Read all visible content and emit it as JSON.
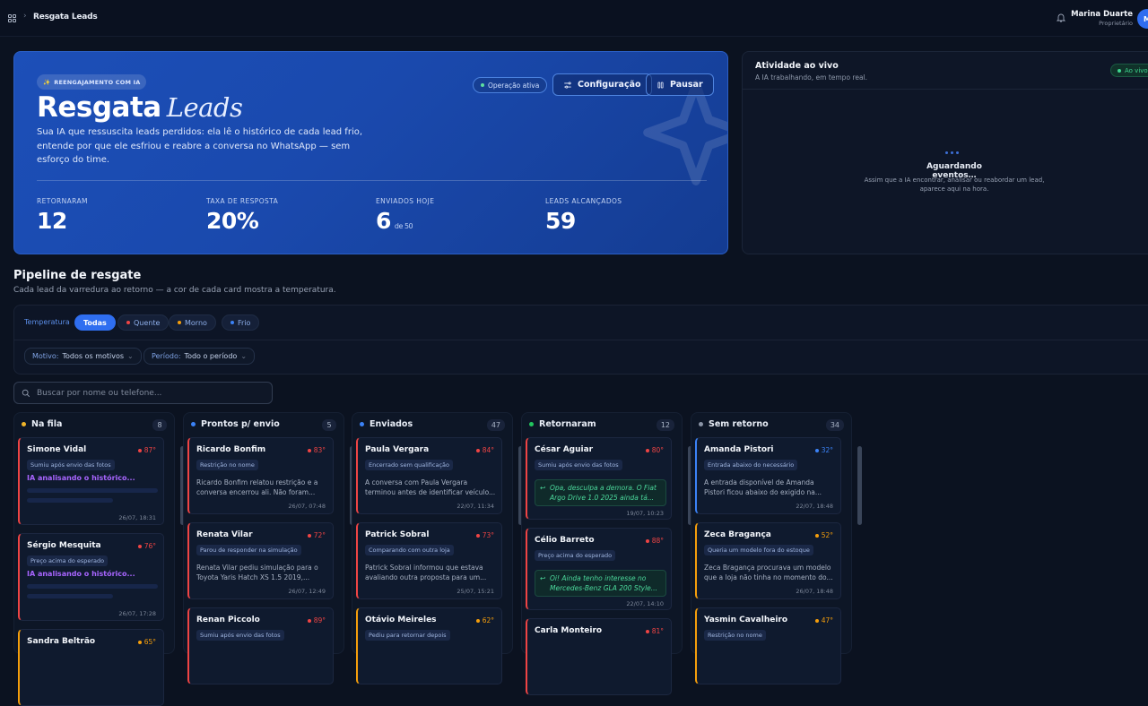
{
  "topbar": {
    "breadcrumb": "Resgata Leads",
    "user_name": "Marina Duarte",
    "user_role": "Proprietário",
    "avatar_initial": "M"
  },
  "hero": {
    "badge": "REENGAJAMENTO COM IA",
    "title_bold": "Resgata",
    "title_italic": "Leads",
    "description": "Sua IA que ressuscita leads perdidos: ela lê o histórico de cada lead frio, entende por que ele esfriou e reabre a conversa no WhatsApp — sem esforço do time.",
    "status": "Operação ativa",
    "config_label": "Configuração",
    "pause_label": "Pausar",
    "stats": [
      {
        "label": "RETORNARAM",
        "value": "12",
        "suffix": ""
      },
      {
        "label": "TAXA DE RESPOSTA",
        "value": "20%",
        "suffix": ""
      },
      {
        "label": "ENVIADOS HOJE",
        "value": "6",
        "suffix": "de 50"
      },
      {
        "label": "LEADS ALCANÇADOS",
        "value": "59",
        "suffix": ""
      }
    ]
  },
  "activity": {
    "title": "Atividade ao vivo",
    "subtitle": "A IA trabalhando, em tempo real.",
    "live": "Ao vivo",
    "waiting": "Aguardando eventos…",
    "help": "Assim que a IA encontrar, analisar ou reabordar um lead, aparece aqui na hora."
  },
  "pipeline": {
    "title": "Pipeline de resgate",
    "subtitle": "Cada lead da varredura ao retorno — a cor de cada card mostra a temperatura.",
    "temp_label": "Temperatura",
    "chips": [
      "Todas",
      "Quente",
      "Morno",
      "Frio"
    ],
    "motivo_label": "Motivo:",
    "motivo_value": "Todos os motivos",
    "periodo_label": "Período:",
    "periodo_value": "Todo o período",
    "search_placeholder": "Buscar por nome ou telefone..."
  },
  "colors": {
    "hot": "#ef4444",
    "warm": "#f59e0b",
    "cold": "#3b82f6",
    "green": "#22c55e",
    "analyze": "#a865ff"
  },
  "columns": [
    {
      "title": "Na fila",
      "count": "8",
      "dot": "#f0b429",
      "cards": [
        {
          "name": "Simone Vidal",
          "temp": "87°",
          "tag": "Sumiu após envio das fotos",
          "analyzing": "IA analisando o histórico...",
          "time": "26/07, 18:31",
          "color": "#ef4444"
        },
        {
          "name": "Sérgio Mesquita",
          "temp": "76°",
          "tag": "Preço acima do esperado",
          "analyzing": "IA analisando o histórico...",
          "time": "26/07, 17:28",
          "color": "#ef4444"
        },
        {
          "name": "Sandra Beltrão",
          "temp": "65°",
          "tag": "",
          "color": "#f59e0b"
        }
      ]
    },
    {
      "title": "Prontos p/ envio",
      "count": "5",
      "dot": "#3b82f6",
      "cards": [
        {
          "name": "Ricardo Bonfim",
          "temp": "83°",
          "tag": "Restrição no nome",
          "text": "Ricardo Bonfim relatou restrição e a conversa encerrou ali. Não foram...",
          "time": "26/07, 07:48",
          "color": "#ef4444"
        },
        {
          "name": "Renata Vilar",
          "temp": "72°",
          "tag": "Parou de responder na simulação",
          "text": "Renata Vilar pediu simulação para o Toyota Yaris Hatch XS 1.5 2019,...",
          "time": "26/07, 12:49",
          "color": "#ef4444"
        },
        {
          "name": "Renan Piccolo",
          "temp": "89°",
          "tag": "Sumiu após envio das fotos",
          "color": "#ef4444"
        }
      ]
    },
    {
      "title": "Enviados",
      "count": "47",
      "dot": "#3b82f6",
      "cards": [
        {
          "name": "Paula Vergara",
          "temp": "84°",
          "tag": "Encerrado sem qualificação",
          "text": "A conversa com Paula Vergara terminou antes de identificar veículo...",
          "time": "22/07, 11:34",
          "color": "#ef4444"
        },
        {
          "name": "Patrick Sobral",
          "temp": "73°",
          "tag": "Comparando com outra loja",
          "text": "Patrick Sobral informou que estava avaliando outra proposta para um...",
          "time": "25/07, 15:21",
          "color": "#ef4444"
        },
        {
          "name": "Otávio Meireles",
          "temp": "62°",
          "tag": "Pediu para retornar depois",
          "color": "#f59e0b"
        }
      ]
    },
    {
      "title": "Retornaram",
      "count": "12",
      "dot": "#22c55e",
      "cards": [
        {
          "name": "César Aguiar",
          "temp": "80°",
          "tag": "Sumiu após envio das fotos",
          "reply": "Opa, desculpa a demora. O Fiat Argo Drive 1.0 2025 ainda tá...",
          "time": "19/07, 10:23",
          "color": "#ef4444"
        },
        {
          "name": "Célio Barreto",
          "temp": "88°",
          "tag": "Preço acima do esperado",
          "reply": "Oi! Ainda tenho interesse no Mercedes-Benz GLA 200 Style...",
          "time": "22/07, 14:10",
          "color": "#ef4444"
        },
        {
          "name": "Carla Monteiro",
          "temp": "81°",
          "tag": "",
          "color": "#ef4444"
        }
      ]
    },
    {
      "title": "Sem retorno",
      "count": "34",
      "dot": "#8a94a6",
      "cards": [
        {
          "name": "Amanda Pistori",
          "temp": "32°",
          "tag": "Entrada abaixo do necessário",
          "text": "A entrada disponível de Amanda Pistori ficou abaixo do exigido na...",
          "time": "22/07, 18:48",
          "color": "#3b82f6"
        },
        {
          "name": "Zeca Bragança",
          "temp": "52°",
          "tag": "Queria um modelo fora do estoque",
          "text": "Zeca Bragança procurava um modelo que a loja não tinha no momento do...",
          "time": "26/07, 18:48",
          "color": "#f59e0b"
        },
        {
          "name": "Yasmin Cavalheiro",
          "temp": "47°",
          "tag": "Restrição no nome",
          "color": "#f59e0b"
        }
      ]
    }
  ]
}
